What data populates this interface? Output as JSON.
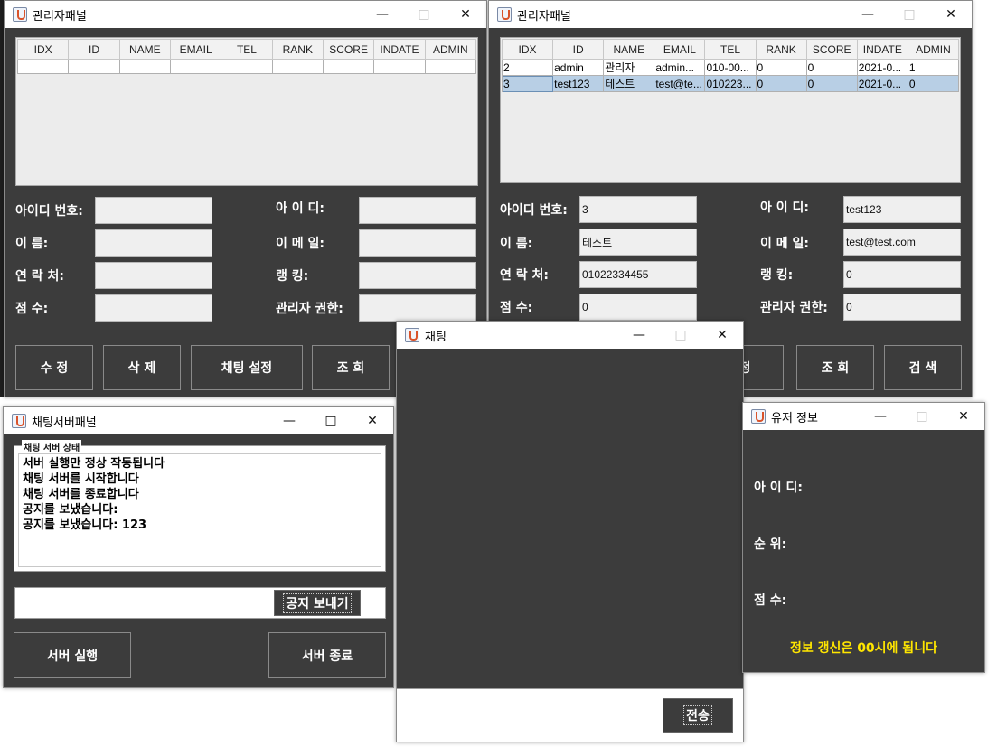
{
  "admin_panel_1": {
    "title": "관리자패널",
    "table": {
      "headers": [
        "IDX",
        "ID",
        "NAME",
        "EMAIL",
        "TEL",
        "RANK",
        "SCORE",
        "INDATE",
        "ADMIN"
      ],
      "rows": [
        [
          "",
          "",
          "",
          "",
          "",
          "",
          "",
          "",
          ""
        ]
      ]
    },
    "labels": {
      "idx": "아이디 번호:",
      "name": "이 름:",
      "tel": "연 락 처:",
      "score": "점 수:",
      "id": "아 이 디:",
      "email": "이 메 일:",
      "rank": "랭 킹:",
      "admin": "관리자 권한:"
    },
    "values": {
      "idx": "",
      "name": "",
      "tel": "",
      "score": "",
      "id": "",
      "email": "",
      "rank": "",
      "admin": ""
    },
    "buttons": {
      "edit": "수 정",
      "delete": "삭 제",
      "chat_settings": "채팅 설정",
      "lookup": "조 회"
    }
  },
  "admin_panel_2": {
    "title": "관리자패널",
    "table": {
      "headers": [
        "IDX",
        "ID",
        "NAME",
        "EMAIL",
        "TEL",
        "RANK",
        "SCORE",
        "INDATE",
        "ADMIN"
      ],
      "rows": [
        [
          "2",
          "admin",
          "관리자",
          "admin...",
          "010-00...",
          "0",
          "0",
          "2021-0...",
          "1"
        ],
        [
          "3",
          "test123",
          "테스트",
          "test@te...",
          "010223...",
          "0",
          "0",
          "2021-0...",
          "0"
        ]
      ],
      "selected_row": 1
    },
    "labels": {
      "idx": "아이디 번호:",
      "name": "이 름:",
      "tel": "연 락 처:",
      "score": "점 수:",
      "id": "아 이 디:",
      "email": "이 메 일:",
      "rank": "랭 킹:",
      "admin": "관리자 권한:"
    },
    "values": {
      "idx": "3",
      "name": "테스트",
      "tel": "01022334455",
      "score": "0",
      "id": "test123",
      "email": "test@test.com",
      "rank": "0",
      "admin": "0"
    },
    "buttons": {
      "edit_partial": "정",
      "lookup": "조 회",
      "search": "검 색"
    }
  },
  "chat_server_panel": {
    "title": "채팅서버패널",
    "group_title": "채팅 서버 상태",
    "log_lines": [
      "서버 실행만 정상 작동됩니다",
      "채팅 서버를 시작합니다",
      "채팅 서버를 종료합니다",
      "공지를 보냈습니다:",
      "공지를 보냈습니다: 123"
    ],
    "notice_input_value": "",
    "notice_button": "공지 보내기",
    "start_button": "서버 실행",
    "stop_button": "서버 종료"
  },
  "chat_window": {
    "title": "채팅",
    "message_input_value": "",
    "send_button": "전송"
  },
  "user_info": {
    "title": "유저 정보",
    "id_label": "아 이 디:",
    "rank_label": "순 위:",
    "score_label": "점 수:",
    "notice": "정보 갱신은 00시에 됩니다"
  },
  "colors": {
    "window_bg": "#3c3c3c",
    "selected_row": "#b8cfe5",
    "notice_yellow": "#ffe600"
  }
}
